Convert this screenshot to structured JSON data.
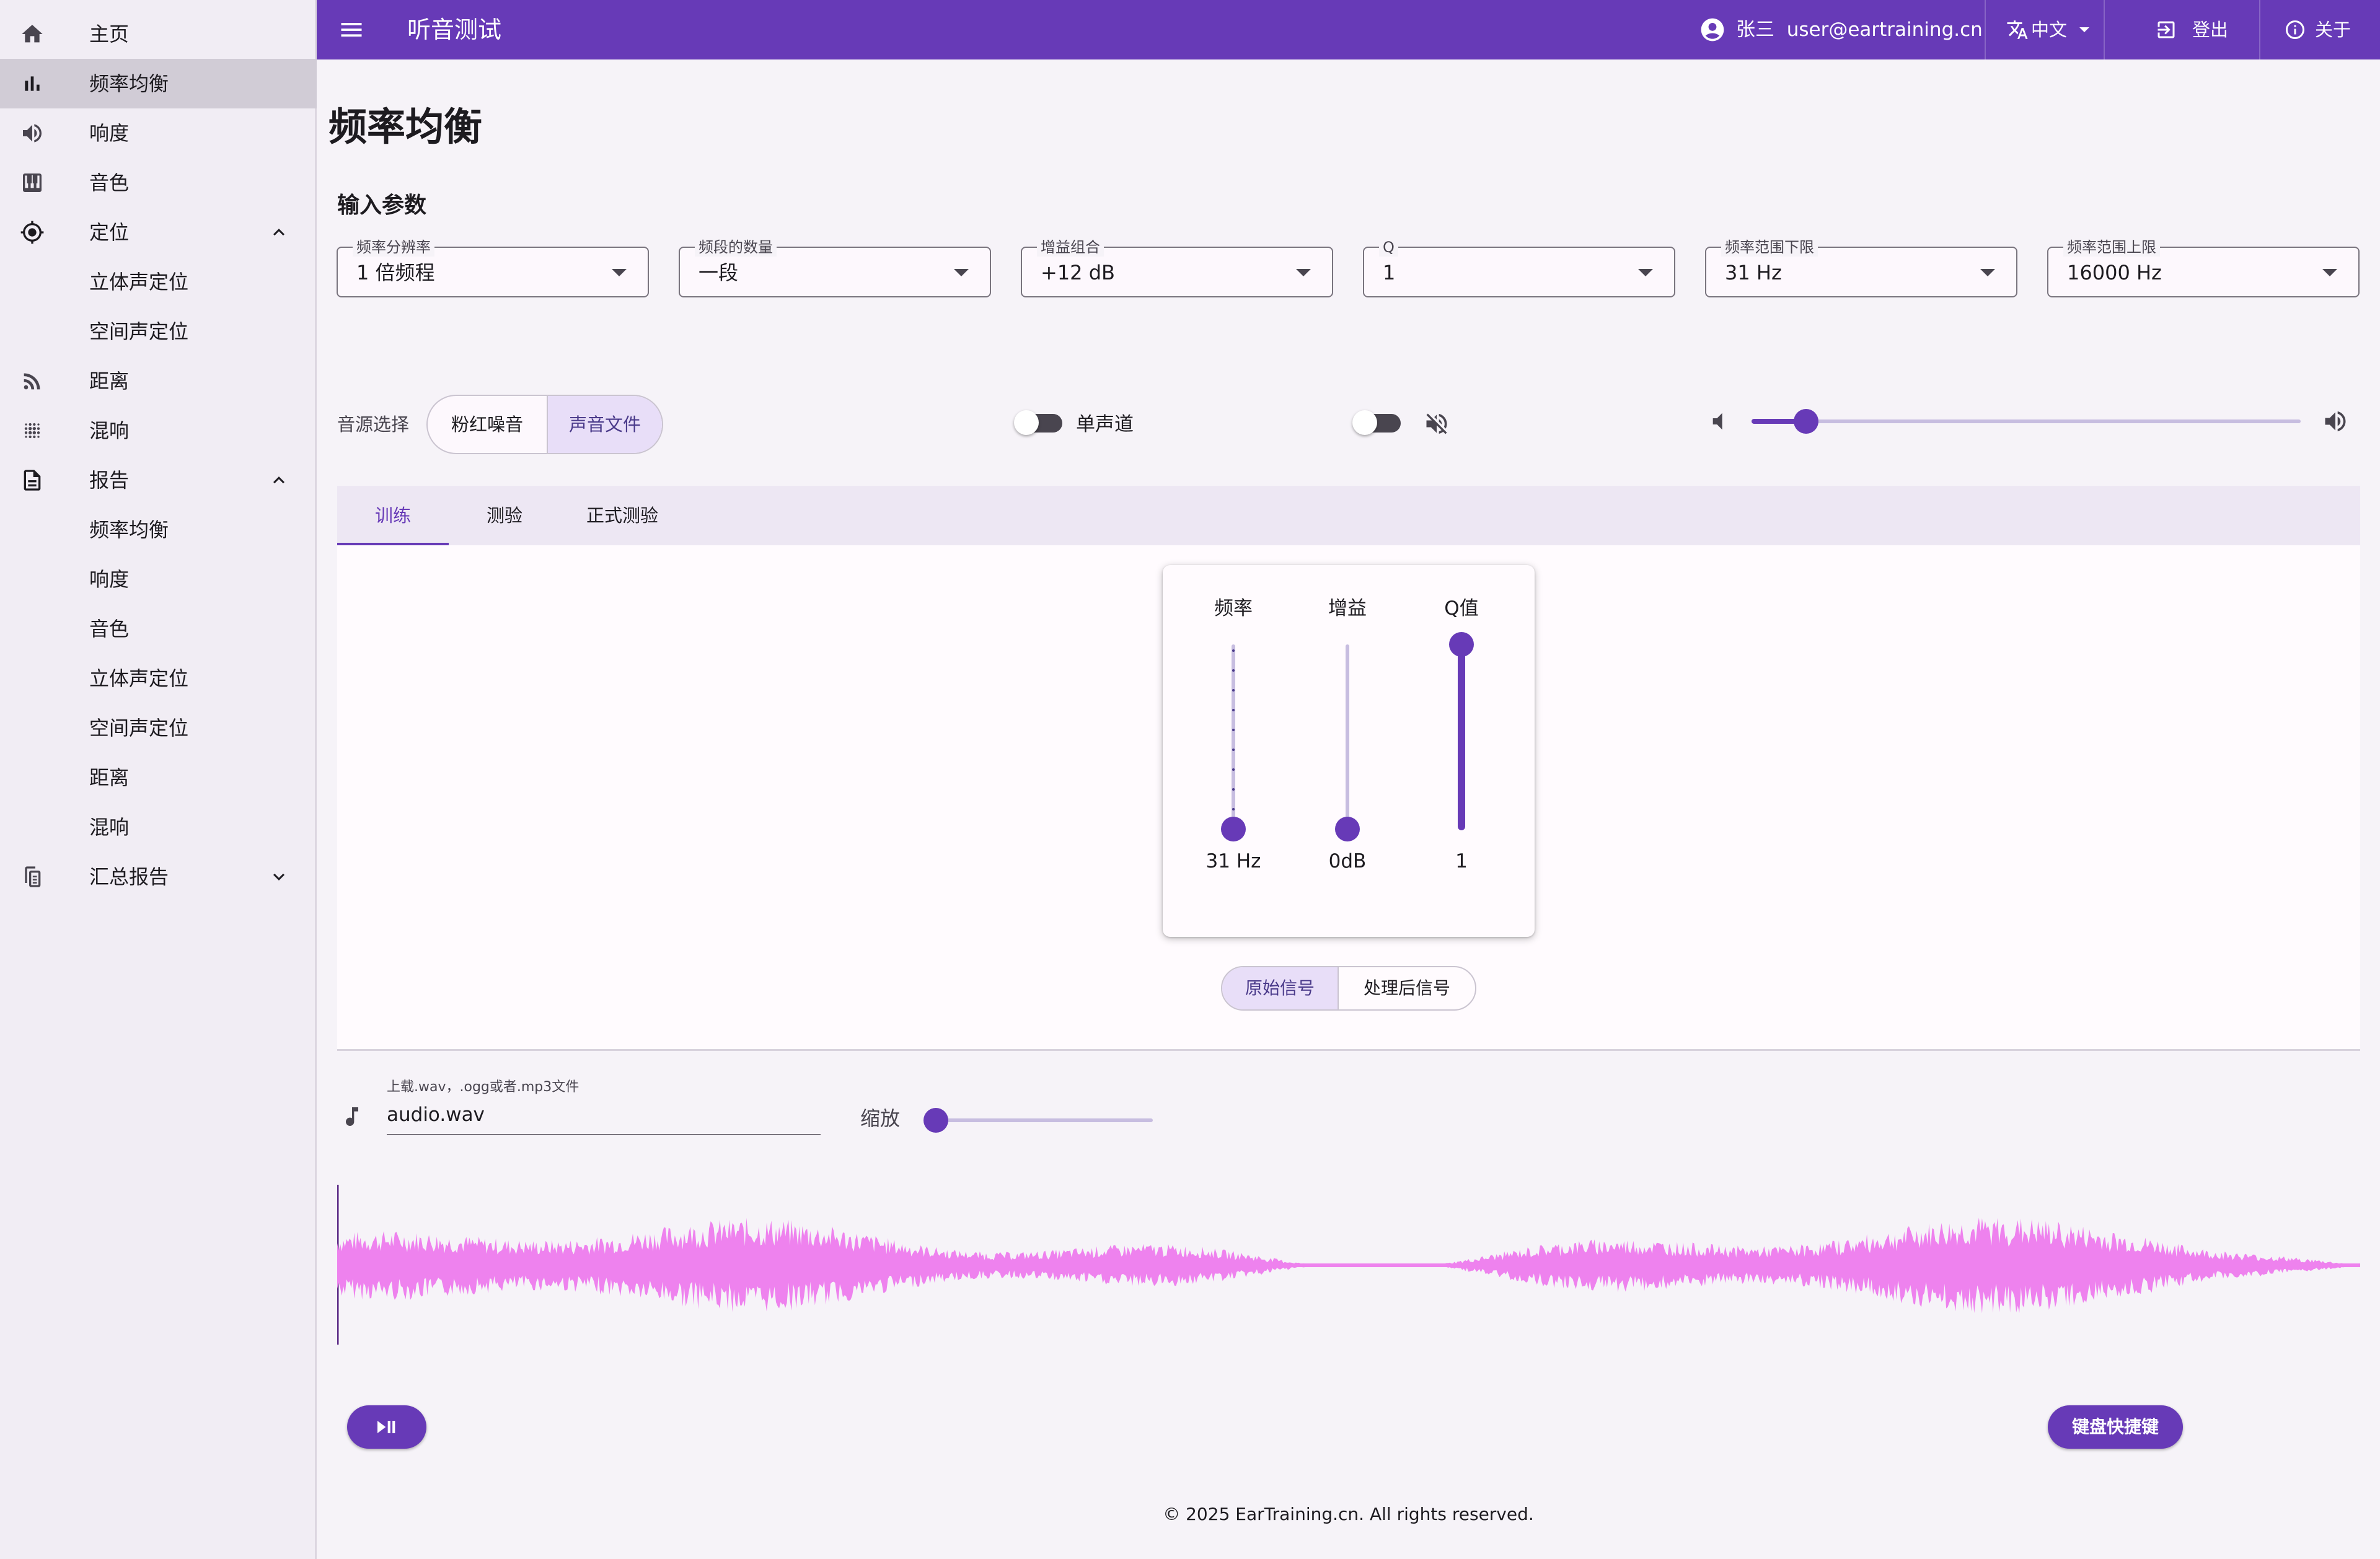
{
  "app": {
    "title": "听音测试"
  },
  "header": {
    "user_name": "张三",
    "user_email": "user@eartraining.cn",
    "language": "中文",
    "logout": "登出",
    "about": "关于"
  },
  "sidebar": {
    "home": "主页",
    "frequency_eq": "频率均衡",
    "loudness": "响度",
    "timbre": "音色",
    "localization": "定位",
    "stereo_localization": "立体声定位",
    "spatial_localization": "空间声定位",
    "distance": "距离",
    "reverb": "混响",
    "reports": "报告",
    "report_items": [
      "频率均衡",
      "响度",
      "音色",
      "立体声定位",
      "空间声定位",
      "距离",
      "混响"
    ],
    "summary_report": "汇总报告"
  },
  "page": {
    "title": "频率均衡",
    "input_params": "输入参数"
  },
  "fields": [
    {
      "label": "频率分辨率",
      "value": "1 倍频程"
    },
    {
      "label": "频段的数量",
      "value": "一段"
    },
    {
      "label": "增益组合",
      "value": "+12 dB"
    },
    {
      "label": "Q",
      "value": "1"
    },
    {
      "label": "频率范围下限",
      "value": "31 Hz"
    },
    {
      "label": "频率范围上限",
      "value": "16000 Hz"
    }
  ],
  "source": {
    "label": "音源选择",
    "options": [
      "粉红噪音",
      "声音文件"
    ],
    "selected": "声音文件"
  },
  "toggles": {
    "mono_label": "单声道",
    "mono_on": false,
    "mute_on": false
  },
  "volume": {
    "level": 0.1
  },
  "tabs": {
    "items": [
      "训练",
      "测验",
      "正式测验"
    ],
    "active": "训练"
  },
  "eq": {
    "freq_label": "频率",
    "gain_label": "增益",
    "q_label": "Q值",
    "freq_value": "31 Hz",
    "gain_value": "0dB",
    "q_value": "1",
    "q_level": 1
  },
  "signal": {
    "options": [
      "原始信号",
      "处理后信号"
    ],
    "selected": "原始信号"
  },
  "upload": {
    "label": "上载.wav，.ogg或者.mp3文件",
    "value": "audio.wav"
  },
  "zoom": {
    "label": "缩放",
    "level": 0
  },
  "waveform": {
    "color": "#ee82ee"
  },
  "buttons": {
    "shortcuts": "键盘快捷键"
  },
  "footer": {
    "text": "© 2025 EarTraining.cn. All rights reserved."
  },
  "colors": {
    "primary": "#673ab7",
    "waveform": "#ee82ee"
  }
}
